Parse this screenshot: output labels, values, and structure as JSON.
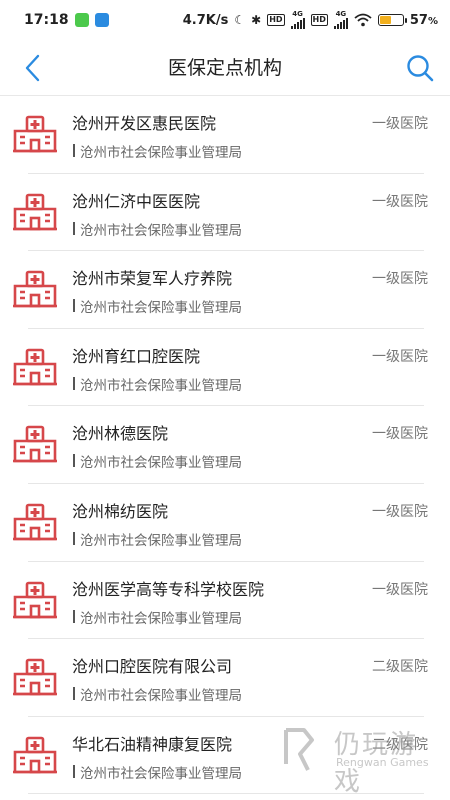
{
  "status_bar": {
    "time": "17:18",
    "speed": "4.7K/s",
    "hd1": "HD",
    "net1": "4G",
    "hd2": "HD",
    "net2": "4G",
    "battery_percent_label": "57",
    "battery_percent_suffix": "%",
    "battery_level": 0.57,
    "battery_color": "#f2b01e"
  },
  "nav": {
    "title": "医保定点机构",
    "accent": "#2b8be0"
  },
  "icon_color": "#d6474a",
  "hospitals": [
    {
      "name": "沧州开发区惠民医院",
      "level": "一级医院",
      "authority": "沧州市社会保险事业管理局"
    },
    {
      "name": "沧州仁济中医医院",
      "level": "一级医院",
      "authority": "沧州市社会保险事业管理局"
    },
    {
      "name": "沧州市荣复军人疗养院",
      "level": "一级医院",
      "authority": "沧州市社会保险事业管理局"
    },
    {
      "name": "沧州育红口腔医院",
      "level": "一级医院",
      "authority": "沧州市社会保险事业管理局"
    },
    {
      "name": "沧州林德医院",
      "level": "一级医院",
      "authority": "沧州市社会保险事业管理局"
    },
    {
      "name": "沧州棉纺医院",
      "level": "一级医院",
      "authority": "沧州市社会保险事业管理局"
    },
    {
      "name": "沧州医学高等专科学校医院",
      "level": "一级医院",
      "authority": "沧州市社会保险事业管理局"
    },
    {
      "name": "沧州口腔医院有限公司",
      "level": "二级医院",
      "authority": "沧州市社会保险事业管理局"
    },
    {
      "name": "华北石油精神康复医院",
      "level": "二级医院",
      "authority": "沧州市社会保险事业管理局"
    }
  ],
  "watermark": {
    "cn": "仍玩游戏",
    "en": "Rengwan Games"
  }
}
